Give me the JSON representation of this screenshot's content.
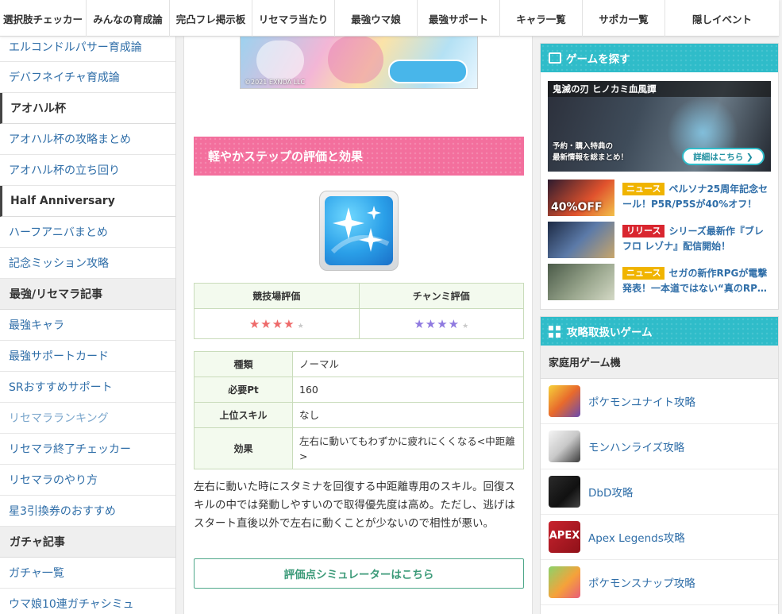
{
  "nav": {
    "items": [
      {
        "label": "選択肢チェッカー",
        "w": 109
      },
      {
        "label": "みんなの育成論",
        "w": 105
      },
      {
        "label": "完凸フレ掲示板",
        "w": 104
      },
      {
        "label": "リセマラ当たり",
        "w": 104
      },
      {
        "label": "最強ウマ娘",
        "w": 104
      },
      {
        "label": "最強サポート",
        "w": 104
      },
      {
        "label": "キャラ一覧",
        "w": 104
      },
      {
        "label": "サポカ一覧",
        "w": 104
      },
      {
        "label": "隠しイベント",
        "w": 143
      }
    ]
  },
  "sidebar": {
    "rows": [
      {
        "type": "link",
        "label": "エルコンドルパサー育成論",
        "first": true
      },
      {
        "type": "link",
        "label": "デバフネイチャ育成論"
      },
      {
        "type": "head",
        "label": "アオハル杯",
        "style": "bar"
      },
      {
        "type": "link",
        "label": "アオハル杯の攻略まとめ"
      },
      {
        "type": "link",
        "label": "アオハル杯の立ち回り"
      },
      {
        "type": "head",
        "label": "Half Anniversary",
        "style": "bar"
      },
      {
        "type": "link",
        "label": "ハーフアニバまとめ"
      },
      {
        "type": "link",
        "label": "記念ミッション攻略"
      },
      {
        "type": "head",
        "label": "最強/リセマラ記事",
        "style": "grey"
      },
      {
        "type": "link",
        "label": "最強キャラ"
      },
      {
        "type": "link",
        "label": "最強サポートカード"
      },
      {
        "type": "link",
        "label": "SRおすすめサポート"
      },
      {
        "type": "link",
        "label": "リセマラランキング",
        "visited": true
      },
      {
        "type": "link",
        "label": "リセマラ終了チェッカー"
      },
      {
        "type": "link",
        "label": "リセマラのやり方"
      },
      {
        "type": "link",
        "label": "星3引換券のおすすめ"
      },
      {
        "type": "head",
        "label": "ガチャ記事",
        "style": "grey"
      },
      {
        "type": "link",
        "label": "ガチャ一覧"
      },
      {
        "type": "link",
        "label": "ウマ娘10連ガチャシミュ"
      }
    ]
  },
  "main": {
    "banner_copyright": "©2021 EXNOA LLC",
    "section_title": "軽やかステップの評価と効果",
    "rating": {
      "header_left": "競技場評価",
      "header_right": "チャンミ評価",
      "left_stars": "★★★★",
      "right_stars": "★★★★",
      "off_star": "★",
      "left_score": 4,
      "right_score": 4,
      "max_score": 5
    },
    "info": {
      "rows": [
        {
          "label": "種類",
          "value": "ノーマル"
        },
        {
          "label": "必要Pt",
          "value": "160"
        },
        {
          "label": "上位スキル",
          "value": "なし"
        },
        {
          "label": "効果",
          "value": "左右に動いてもわずかに疲れにくくなる<中距離>"
        }
      ]
    },
    "description": "左右に動いた時にスタミナを回復する中距離専用のスキル。回復スキルの中では発動しやすいので取得優先度は高め。ただし、逃げはスタート直後以外で左右に動くことが少ないので相性が悪い。",
    "simulator_button": "評価点シミュレーターはこちら"
  },
  "right": {
    "find_games": {
      "title": "ゲームを探す",
      "featured": {
        "title": "鬼滅の刃 ヒノカミ血風譚",
        "line1": "予約・購入特典の",
        "line2": "最新情報を総まとめ！",
        "button": "詳細はこちら ❯"
      },
      "news": [
        {
          "tag": "ニュース",
          "tag_color": "#f0b400",
          "text": "ペルソナ25周年記念セール！P5R/P5Sが40%オフ！",
          "thumb_text": "40%OFF"
        },
        {
          "tag": "リリース",
          "tag_color": "#d9262f",
          "text": "シリーズ最新作『ブレフロ レゾナ』配信開始！",
          "thumb_text": ""
        },
        {
          "tag": "ニュース",
          "tag_color": "#f0b400",
          "text": "セガの新作RPGが電撃発表！一本道ではない“真のRP…",
          "thumb_text": ""
        }
      ]
    },
    "games": {
      "title": "攻略取扱いゲーム",
      "subheading": "家庭用ゲーム機",
      "items": [
        {
          "label": "ポケモンユナイト攻略",
          "icon": "pokemon-unite-icon"
        },
        {
          "label": "モンハンライズ攻略",
          "icon": "monster-hunter-rise-icon"
        },
        {
          "label": "DbD攻略",
          "icon": "dbd-icon"
        },
        {
          "label": "Apex Legends攻略",
          "icon": "apex-icon",
          "icon_text": "APEX"
        },
        {
          "label": "ポケモンスナップ攻略",
          "icon": "pokemon-snap-icon"
        }
      ]
    }
  }
}
